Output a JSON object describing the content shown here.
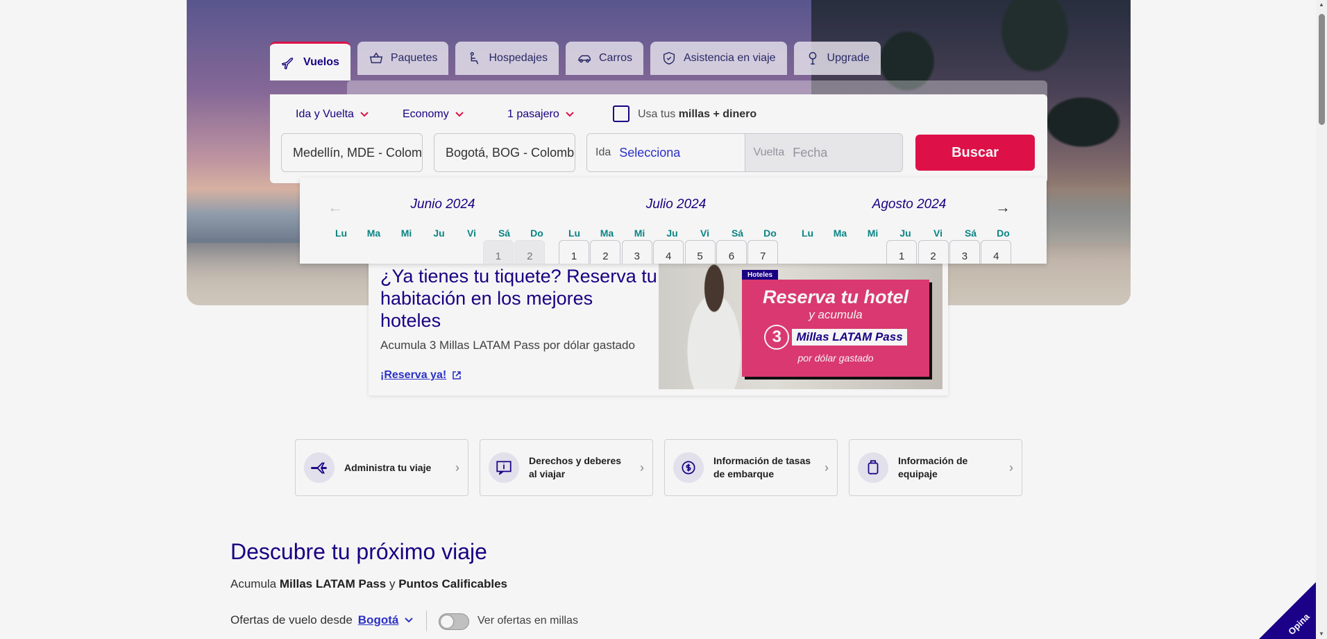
{
  "tabs": [
    {
      "label": "Vuelos",
      "icon": "plane-icon",
      "active": true
    },
    {
      "label": "Paquetes",
      "icon": "package-icon"
    },
    {
      "label": "Hospedajes",
      "icon": "bed-icon"
    },
    {
      "label": "Carros",
      "icon": "car-icon"
    },
    {
      "label": "Asistencia en viaje",
      "icon": "shield-icon"
    },
    {
      "label": "Upgrade",
      "icon": "upgrade-icon"
    }
  ],
  "search": {
    "trip_type": "Ida y Vuelta",
    "cabin": "Economy",
    "passengers": "1 pasajero",
    "miles_prefix": "Usa tus ",
    "miles_bold": "millas + dinero",
    "origin": "Medellín, MDE - Colombia",
    "destination": "Bogotá, BOG - Colombia",
    "ida_label": "Ida",
    "ida_value": "Selecciona",
    "vuelta_label": "Vuelta",
    "vuelta_value": "Fecha",
    "button": "Buscar"
  },
  "calendar": {
    "dows": [
      "Lu",
      "Ma",
      "Mi",
      "Ju",
      "Vi",
      "Sá",
      "Do"
    ],
    "months": [
      {
        "name": "Junio 2024",
        "offset": 5,
        "days": [
          "1",
          "2"
        ],
        "disabled": true
      },
      {
        "name": "Julio 2024",
        "offset": 0,
        "days": [
          "1",
          "2",
          "3",
          "4",
          "5",
          "6",
          "7"
        ],
        "disabled": false
      },
      {
        "name": "Agosto 2024",
        "offset": 3,
        "days": [
          "1",
          "2",
          "3",
          "4"
        ],
        "disabled": false
      }
    ],
    "prev": "←",
    "next": "→"
  },
  "promo": {
    "title": "¿Ya tienes tu tiquete? Reserva tu habitación en los mejores hoteles",
    "text": "Acumula 3 Millas LATAM Pass por dólar gastado",
    "link": "¡Reserva ya!",
    "tag": "Hoteles",
    "img_t1": "Reserva tu hotel",
    "img_t2": "y acumula",
    "img_num": "3",
    "img_hl": "Millas LATAM Pass",
    "img_t3": "por dólar gastado"
  },
  "quicklinks": [
    {
      "label": "Administra tu viaje",
      "icon": "plane-icon"
    },
    {
      "label": "Derechos y deberes al viajar",
      "icon": "info-icon"
    },
    {
      "label": "Información de tasas de embarque",
      "icon": "money-icon"
    },
    {
      "label": "Información de equipaje",
      "icon": "luggage-icon"
    }
  ],
  "discover": {
    "title": "Descubre tu próximo viaje",
    "sub_prefix": "Acumula ",
    "sub_b1": "Millas LATAM Pass",
    "sub_mid": " y ",
    "sub_b2": "Puntos Calificables",
    "offers_label": "Ofertas de vuelo desde",
    "offers_city": "Bogotá",
    "toggle_label": "Ver ofertas en millas"
  },
  "opina": "Opina",
  "colors": {
    "brand": "#1b0088",
    "accent": "#e8114b",
    "link": "#2d34ce",
    "dow": "#0b8a8a"
  }
}
